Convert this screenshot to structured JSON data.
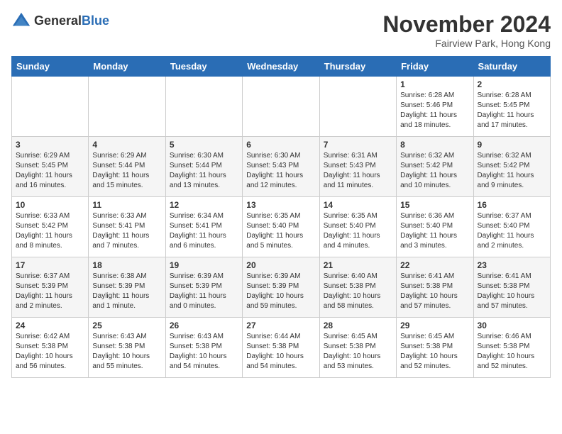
{
  "header": {
    "logo_general": "General",
    "logo_blue": "Blue",
    "month": "November 2024",
    "location": "Fairview Park, Hong Kong"
  },
  "days_of_week": [
    "Sunday",
    "Monday",
    "Tuesday",
    "Wednesday",
    "Thursday",
    "Friday",
    "Saturday"
  ],
  "weeks": [
    [
      {
        "day": "",
        "info": ""
      },
      {
        "day": "",
        "info": ""
      },
      {
        "day": "",
        "info": ""
      },
      {
        "day": "",
        "info": ""
      },
      {
        "day": "",
        "info": ""
      },
      {
        "day": "1",
        "info": "Sunrise: 6:28 AM\nSunset: 5:46 PM\nDaylight: 11 hours and 18 minutes."
      },
      {
        "day": "2",
        "info": "Sunrise: 6:28 AM\nSunset: 5:45 PM\nDaylight: 11 hours and 17 minutes."
      }
    ],
    [
      {
        "day": "3",
        "info": "Sunrise: 6:29 AM\nSunset: 5:45 PM\nDaylight: 11 hours and 16 minutes."
      },
      {
        "day": "4",
        "info": "Sunrise: 6:29 AM\nSunset: 5:44 PM\nDaylight: 11 hours and 15 minutes."
      },
      {
        "day": "5",
        "info": "Sunrise: 6:30 AM\nSunset: 5:44 PM\nDaylight: 11 hours and 13 minutes."
      },
      {
        "day": "6",
        "info": "Sunrise: 6:30 AM\nSunset: 5:43 PM\nDaylight: 11 hours and 12 minutes."
      },
      {
        "day": "7",
        "info": "Sunrise: 6:31 AM\nSunset: 5:43 PM\nDaylight: 11 hours and 11 minutes."
      },
      {
        "day": "8",
        "info": "Sunrise: 6:32 AM\nSunset: 5:42 PM\nDaylight: 11 hours and 10 minutes."
      },
      {
        "day": "9",
        "info": "Sunrise: 6:32 AM\nSunset: 5:42 PM\nDaylight: 11 hours and 9 minutes."
      }
    ],
    [
      {
        "day": "10",
        "info": "Sunrise: 6:33 AM\nSunset: 5:42 PM\nDaylight: 11 hours and 8 minutes."
      },
      {
        "day": "11",
        "info": "Sunrise: 6:33 AM\nSunset: 5:41 PM\nDaylight: 11 hours and 7 minutes."
      },
      {
        "day": "12",
        "info": "Sunrise: 6:34 AM\nSunset: 5:41 PM\nDaylight: 11 hours and 6 minutes."
      },
      {
        "day": "13",
        "info": "Sunrise: 6:35 AM\nSunset: 5:40 PM\nDaylight: 11 hours and 5 minutes."
      },
      {
        "day": "14",
        "info": "Sunrise: 6:35 AM\nSunset: 5:40 PM\nDaylight: 11 hours and 4 minutes."
      },
      {
        "day": "15",
        "info": "Sunrise: 6:36 AM\nSunset: 5:40 PM\nDaylight: 11 hours and 3 minutes."
      },
      {
        "day": "16",
        "info": "Sunrise: 6:37 AM\nSunset: 5:40 PM\nDaylight: 11 hours and 2 minutes."
      }
    ],
    [
      {
        "day": "17",
        "info": "Sunrise: 6:37 AM\nSunset: 5:39 PM\nDaylight: 11 hours and 2 minutes."
      },
      {
        "day": "18",
        "info": "Sunrise: 6:38 AM\nSunset: 5:39 PM\nDaylight: 11 hours and 1 minute."
      },
      {
        "day": "19",
        "info": "Sunrise: 6:39 AM\nSunset: 5:39 PM\nDaylight: 11 hours and 0 minutes."
      },
      {
        "day": "20",
        "info": "Sunrise: 6:39 AM\nSunset: 5:39 PM\nDaylight: 10 hours and 59 minutes."
      },
      {
        "day": "21",
        "info": "Sunrise: 6:40 AM\nSunset: 5:38 PM\nDaylight: 10 hours and 58 minutes."
      },
      {
        "day": "22",
        "info": "Sunrise: 6:41 AM\nSunset: 5:38 PM\nDaylight: 10 hours and 57 minutes."
      },
      {
        "day": "23",
        "info": "Sunrise: 6:41 AM\nSunset: 5:38 PM\nDaylight: 10 hours and 57 minutes."
      }
    ],
    [
      {
        "day": "24",
        "info": "Sunrise: 6:42 AM\nSunset: 5:38 PM\nDaylight: 10 hours and 56 minutes."
      },
      {
        "day": "25",
        "info": "Sunrise: 6:43 AM\nSunset: 5:38 PM\nDaylight: 10 hours and 55 minutes."
      },
      {
        "day": "26",
        "info": "Sunrise: 6:43 AM\nSunset: 5:38 PM\nDaylight: 10 hours and 54 minutes."
      },
      {
        "day": "27",
        "info": "Sunrise: 6:44 AM\nSunset: 5:38 PM\nDaylight: 10 hours and 54 minutes."
      },
      {
        "day": "28",
        "info": "Sunrise: 6:45 AM\nSunset: 5:38 PM\nDaylight: 10 hours and 53 minutes."
      },
      {
        "day": "29",
        "info": "Sunrise: 6:45 AM\nSunset: 5:38 PM\nDaylight: 10 hours and 52 minutes."
      },
      {
        "day": "30",
        "info": "Sunrise: 6:46 AM\nSunset: 5:38 PM\nDaylight: 10 hours and 52 minutes."
      }
    ]
  ]
}
